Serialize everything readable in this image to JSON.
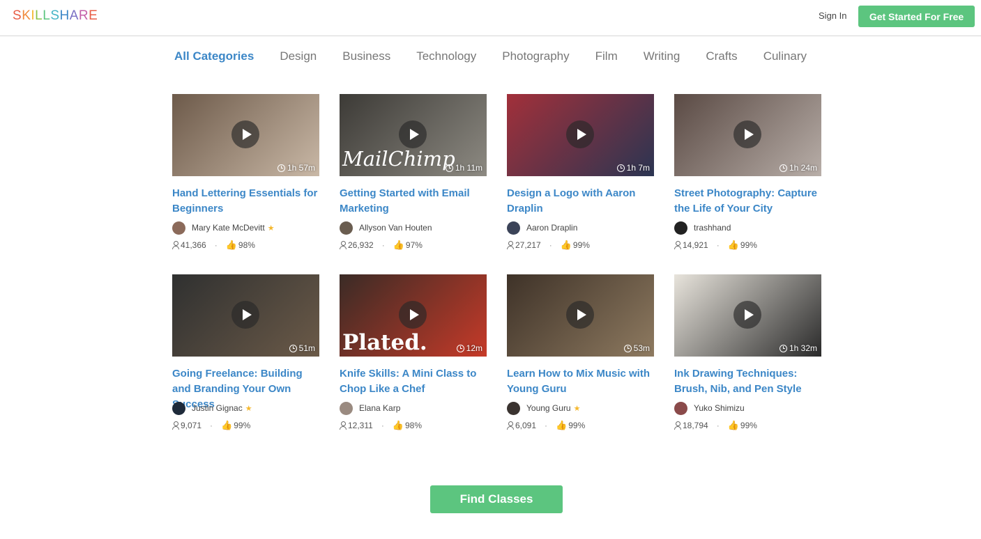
{
  "header": {
    "logo_letters": [
      "S",
      "K",
      "I",
      "L",
      "L",
      "S",
      "H",
      "A",
      "R",
      "E"
    ],
    "logo_colors": [
      "#e85d46",
      "#f08a3c",
      "#f5b82e",
      "#8bc34a",
      "#5cc57f",
      "#45b5c6",
      "#3c87c7",
      "#7a6fc4",
      "#c45fa8",
      "#e85d46"
    ],
    "sign_in": "Sign In",
    "get_started": "Get Started For Free"
  },
  "tabs": [
    {
      "label": "All Categories",
      "active": true
    },
    {
      "label": "Design",
      "active": false
    },
    {
      "label": "Business",
      "active": false
    },
    {
      "label": "Technology",
      "active": false
    },
    {
      "label": "Photography",
      "active": false
    },
    {
      "label": "Film",
      "active": false
    },
    {
      "label": "Writing",
      "active": false
    },
    {
      "label": "Crafts",
      "active": false
    },
    {
      "label": "Culinary",
      "active": false
    }
  ],
  "classes": [
    {
      "title": "Hand Lettering Essentials for Beginners",
      "teacher": "Mary Kate McDevitt",
      "star": true,
      "students": "41,366",
      "rating": "98%",
      "duration": "1h 57m",
      "thumb_colors": [
        "#6d5a4a",
        "#c9b8a6"
      ],
      "avatar_color": "#8b6a5a"
    },
    {
      "title": "Getting Started with Email Marketing",
      "teacher": "Allyson Van Houten",
      "star": false,
      "students": "26,932",
      "rating": "97%",
      "duration": "1h 11m",
      "thumb_colors": [
        "#3c3a36",
        "#8d8a82"
      ],
      "avatar_color": "#6a5d50"
    },
    {
      "title": "Design a Logo with Aaron Draplin",
      "teacher": "Aaron Draplin",
      "star": false,
      "students": "27,217",
      "rating": "99%",
      "duration": "1h 7m",
      "thumb_colors": [
        "#a2303a",
        "#2b3552"
      ],
      "avatar_color": "#3b4358"
    },
    {
      "title": "Street Photography: Capture the Life of Your City",
      "teacher": "trashhand",
      "star": false,
      "students": "14,921",
      "rating": "99%",
      "duration": "1h 24m",
      "thumb_colors": [
        "#5a4a44",
        "#b8aea8"
      ],
      "avatar_color": "#222222"
    },
    {
      "title": "Going Freelance: Building and Branding Your Own Success",
      "teacher": "Justin Gignac",
      "star": true,
      "students": "9,071",
      "rating": "99%",
      "duration": "51m",
      "thumb_colors": [
        "#2f3030",
        "#6b5a48"
      ],
      "avatar_color": "#1e2a3a"
    },
    {
      "title": "Knife Skills: A Mini Class to Chop Like a Chef",
      "teacher": "Elana Karp",
      "star": false,
      "students": "12,311",
      "rating": "98%",
      "duration": "12m",
      "thumb_colors": [
        "#3a2b26",
        "#c63a28"
      ],
      "avatar_color": "#9a8a80"
    },
    {
      "title": "Learn How to Mix Music with Young Guru",
      "teacher": "Young Guru",
      "star": true,
      "students": "6,091",
      "rating": "99%",
      "duration": "53m",
      "thumb_colors": [
        "#3e3228",
        "#8e7a60"
      ],
      "avatar_color": "#3a3330"
    },
    {
      "title": "Ink Drawing Techniques: Brush, Nib, and Pen Style",
      "teacher": "Yuko Shimizu",
      "star": false,
      "students": "18,794",
      "rating": "99%",
      "duration": "1h 32m",
      "thumb_colors": [
        "#e8e4dc",
        "#2a2a2a"
      ],
      "avatar_color": "#8a4a4a"
    }
  ],
  "thumb_text": {
    "mailchimp": "MailChimp",
    "plated": "Plated."
  },
  "find_classes": "Find Classes"
}
